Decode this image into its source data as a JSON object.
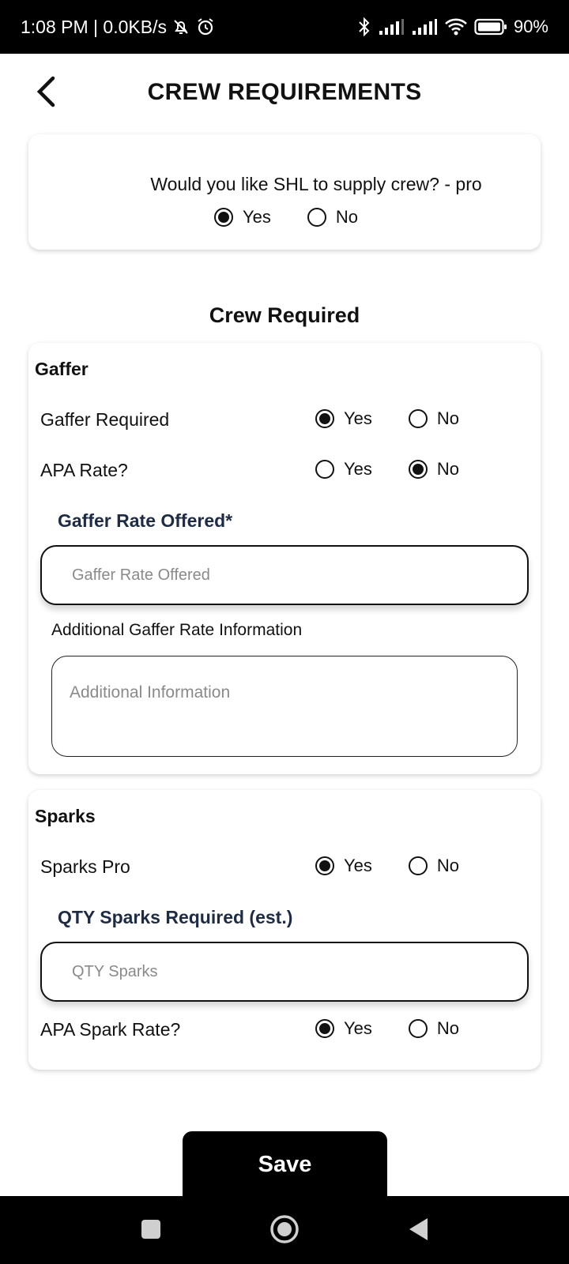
{
  "status_bar": {
    "time_text": "1:08 PM | 0.0KB/s",
    "battery_text": "90%",
    "icons": [
      "mute-icon",
      "alarm-icon",
      "bluetooth-icon",
      "signal-icon",
      "signal-icon",
      "wifi-icon",
      "battery-icon"
    ]
  },
  "header": {
    "title": "CREW REQUIREMENTS",
    "back_icon": "chevron-left-icon"
  },
  "supply": {
    "question": "Would you like SHL to supply crew? - pro",
    "yes_label": "Yes",
    "no_label": "No",
    "selected": "Yes"
  },
  "crew_heading": "Crew Required",
  "gaffer": {
    "title": "Gaffer",
    "required_label": "Gaffer Required",
    "required_yes": "Yes",
    "required_no": "No",
    "required_selected": "Yes",
    "apa_label": "APA Rate?",
    "apa_yes": "Yes",
    "apa_no": "No",
    "apa_selected": "No",
    "rate_label": "Gaffer Rate Offered*",
    "rate_placeholder": "Gaffer Rate Offered",
    "rate_value": "",
    "additional_label": "Additional Gaffer Rate Information",
    "additional_placeholder": "Additional Information",
    "additional_value": ""
  },
  "sparks": {
    "title": "Sparks",
    "pro_label": "Sparks Pro",
    "pro_yes": "Yes",
    "pro_no": "No",
    "pro_selected": "Yes",
    "qty_label": "QTY Sparks Required (est.)",
    "qty_placeholder": "QTY Sparks",
    "qty_value": "",
    "apa_label": "APA Spark Rate?",
    "apa_yes": "Yes",
    "apa_no": "No",
    "apa_selected": "Yes"
  },
  "save_label": "Save",
  "nav": {
    "icons": [
      "recent-apps-icon",
      "home-icon",
      "back-icon"
    ]
  }
}
